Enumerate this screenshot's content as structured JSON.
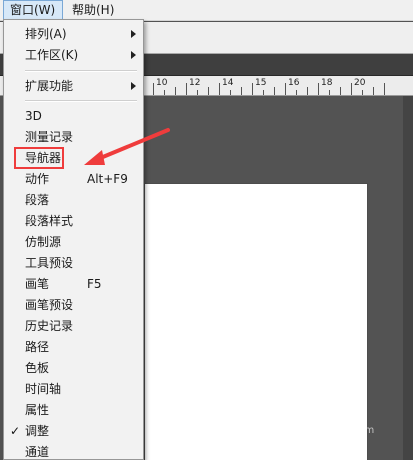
{
  "menubar": {
    "items": [
      {
        "label": "窗口(W)",
        "active": true
      },
      {
        "label": "帮助(H)",
        "active": false
      }
    ]
  },
  "ruler": {
    "labels": [
      "10",
      "12",
      "14",
      "15",
      "16",
      "18",
      "20"
    ]
  },
  "menu": {
    "items": [
      {
        "label": "排列(A)",
        "submenu": true
      },
      {
        "label": "工作区(K)",
        "submenu": true
      },
      {
        "type": "separator"
      },
      {
        "label": "扩展功能",
        "submenu": true
      },
      {
        "type": "separator"
      },
      {
        "label": "3D"
      },
      {
        "label": "测量记录"
      },
      {
        "label": "导航器"
      },
      {
        "label": "动作",
        "shortcut": "Alt+F9"
      },
      {
        "label": "段落"
      },
      {
        "label": "段落样式"
      },
      {
        "label": "仿制源"
      },
      {
        "label": "工具预设"
      },
      {
        "label": "画笔",
        "shortcut": "F5"
      },
      {
        "label": "画笔预设"
      },
      {
        "label": "历史记录"
      },
      {
        "label": "路径"
      },
      {
        "label": "色板"
      },
      {
        "label": "时间轴"
      },
      {
        "label": "属性"
      },
      {
        "label": "调整",
        "checked": true
      },
      {
        "label": "通道"
      }
    ]
  },
  "annotation": {
    "highlight_color": "#ef3c3c"
  },
  "watermark": {
    "text": "jingyan.baidu.com"
  },
  "icons": {
    "submenu": "chevron-right-icon",
    "check": "checkmark-icon"
  }
}
